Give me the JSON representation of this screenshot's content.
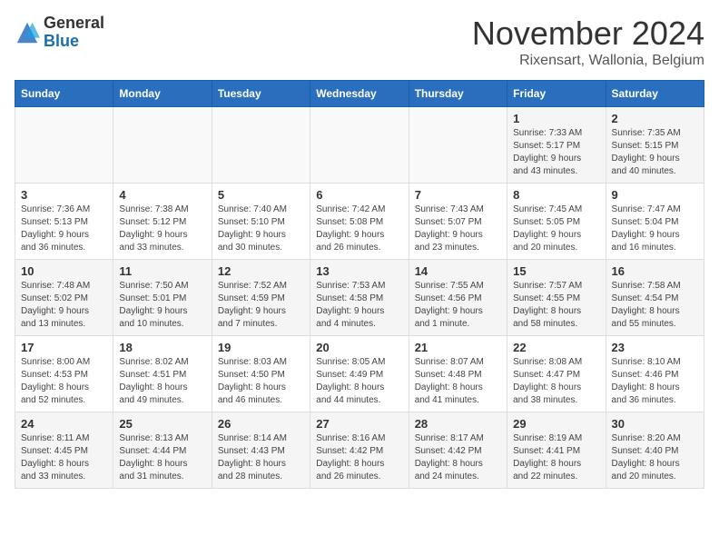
{
  "logo": {
    "general": "General",
    "blue": "Blue"
  },
  "title": "November 2024",
  "location": "Rixensart, Wallonia, Belgium",
  "headers": [
    "Sunday",
    "Monday",
    "Tuesday",
    "Wednesday",
    "Thursday",
    "Friday",
    "Saturday"
  ],
  "weeks": [
    [
      {
        "day": "",
        "detail": ""
      },
      {
        "day": "",
        "detail": ""
      },
      {
        "day": "",
        "detail": ""
      },
      {
        "day": "",
        "detail": ""
      },
      {
        "day": "",
        "detail": ""
      },
      {
        "day": "1",
        "detail": "Sunrise: 7:33 AM\nSunset: 5:17 PM\nDaylight: 9 hours\nand 43 minutes."
      },
      {
        "day": "2",
        "detail": "Sunrise: 7:35 AM\nSunset: 5:15 PM\nDaylight: 9 hours\nand 40 minutes."
      }
    ],
    [
      {
        "day": "3",
        "detail": "Sunrise: 7:36 AM\nSunset: 5:13 PM\nDaylight: 9 hours\nand 36 minutes."
      },
      {
        "day": "4",
        "detail": "Sunrise: 7:38 AM\nSunset: 5:12 PM\nDaylight: 9 hours\nand 33 minutes."
      },
      {
        "day": "5",
        "detail": "Sunrise: 7:40 AM\nSunset: 5:10 PM\nDaylight: 9 hours\nand 30 minutes."
      },
      {
        "day": "6",
        "detail": "Sunrise: 7:42 AM\nSunset: 5:08 PM\nDaylight: 9 hours\nand 26 minutes."
      },
      {
        "day": "7",
        "detail": "Sunrise: 7:43 AM\nSunset: 5:07 PM\nDaylight: 9 hours\nand 23 minutes."
      },
      {
        "day": "8",
        "detail": "Sunrise: 7:45 AM\nSunset: 5:05 PM\nDaylight: 9 hours\nand 20 minutes."
      },
      {
        "day": "9",
        "detail": "Sunrise: 7:47 AM\nSunset: 5:04 PM\nDaylight: 9 hours\nand 16 minutes."
      }
    ],
    [
      {
        "day": "10",
        "detail": "Sunrise: 7:48 AM\nSunset: 5:02 PM\nDaylight: 9 hours\nand 13 minutes."
      },
      {
        "day": "11",
        "detail": "Sunrise: 7:50 AM\nSunset: 5:01 PM\nDaylight: 9 hours\nand 10 minutes."
      },
      {
        "day": "12",
        "detail": "Sunrise: 7:52 AM\nSunset: 4:59 PM\nDaylight: 9 hours\nand 7 minutes."
      },
      {
        "day": "13",
        "detail": "Sunrise: 7:53 AM\nSunset: 4:58 PM\nDaylight: 9 hours\nand 4 minutes."
      },
      {
        "day": "14",
        "detail": "Sunrise: 7:55 AM\nSunset: 4:56 PM\nDaylight: 9 hours\nand 1 minute."
      },
      {
        "day": "15",
        "detail": "Sunrise: 7:57 AM\nSunset: 4:55 PM\nDaylight: 8 hours\nand 58 minutes."
      },
      {
        "day": "16",
        "detail": "Sunrise: 7:58 AM\nSunset: 4:54 PM\nDaylight: 8 hours\nand 55 minutes."
      }
    ],
    [
      {
        "day": "17",
        "detail": "Sunrise: 8:00 AM\nSunset: 4:53 PM\nDaylight: 8 hours\nand 52 minutes."
      },
      {
        "day": "18",
        "detail": "Sunrise: 8:02 AM\nSunset: 4:51 PM\nDaylight: 8 hours\nand 49 minutes."
      },
      {
        "day": "19",
        "detail": "Sunrise: 8:03 AM\nSunset: 4:50 PM\nDaylight: 8 hours\nand 46 minutes."
      },
      {
        "day": "20",
        "detail": "Sunrise: 8:05 AM\nSunset: 4:49 PM\nDaylight: 8 hours\nand 44 minutes."
      },
      {
        "day": "21",
        "detail": "Sunrise: 8:07 AM\nSunset: 4:48 PM\nDaylight: 8 hours\nand 41 minutes."
      },
      {
        "day": "22",
        "detail": "Sunrise: 8:08 AM\nSunset: 4:47 PM\nDaylight: 8 hours\nand 38 minutes."
      },
      {
        "day": "23",
        "detail": "Sunrise: 8:10 AM\nSunset: 4:46 PM\nDaylight: 8 hours\nand 36 minutes."
      }
    ],
    [
      {
        "day": "24",
        "detail": "Sunrise: 8:11 AM\nSunset: 4:45 PM\nDaylight: 8 hours\nand 33 minutes."
      },
      {
        "day": "25",
        "detail": "Sunrise: 8:13 AM\nSunset: 4:44 PM\nDaylight: 8 hours\nand 31 minutes."
      },
      {
        "day": "26",
        "detail": "Sunrise: 8:14 AM\nSunset: 4:43 PM\nDaylight: 8 hours\nand 28 minutes."
      },
      {
        "day": "27",
        "detail": "Sunrise: 8:16 AM\nSunset: 4:42 PM\nDaylight: 8 hours\nand 26 minutes."
      },
      {
        "day": "28",
        "detail": "Sunrise: 8:17 AM\nSunset: 4:42 PM\nDaylight: 8 hours\nand 24 minutes."
      },
      {
        "day": "29",
        "detail": "Sunrise: 8:19 AM\nSunset: 4:41 PM\nDaylight: 8 hours\nand 22 minutes."
      },
      {
        "day": "30",
        "detail": "Sunrise: 8:20 AM\nSunset: 4:40 PM\nDaylight: 8 hours\nand 20 minutes."
      }
    ]
  ]
}
